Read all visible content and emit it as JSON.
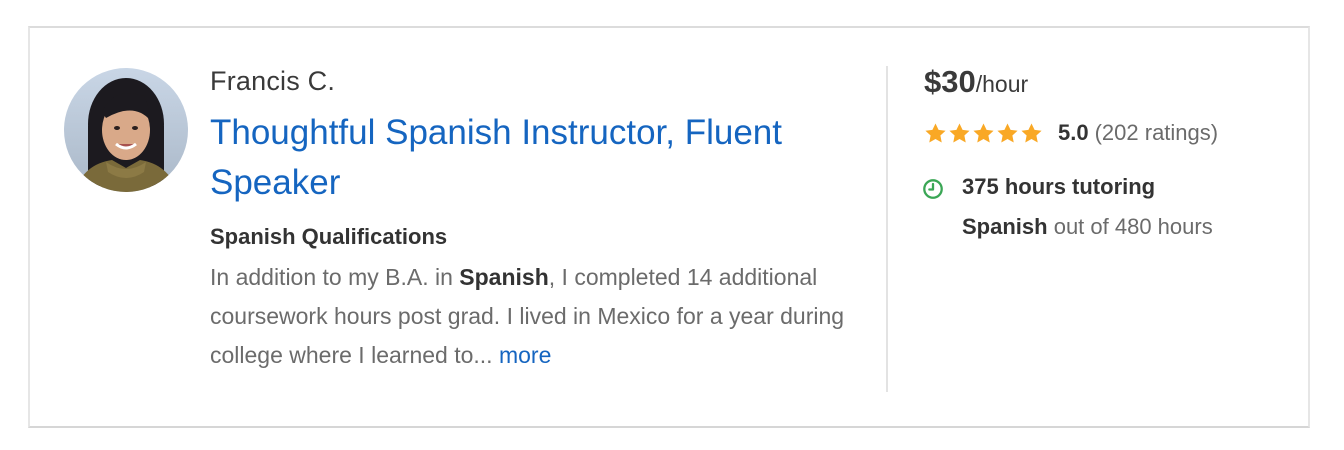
{
  "tutor": {
    "name": "Francis C.",
    "headline": "Thoughtful Spanish Instructor, Fluent Speaker",
    "qualifications": {
      "title": "Spanish Qualifications",
      "text_before_subject": "In addition to my B.A. in ",
      "subject": "Spanish",
      "text_after_subject": ", I completed 14 additional coursework hours post grad. I lived in Mexico for a year during college where I learned to...",
      "more_label": "more"
    }
  },
  "pricing": {
    "price": "$30",
    "unit": "/hour"
  },
  "rating": {
    "stars": 5,
    "score": "5.0",
    "count_text": "(202 ratings)",
    "star_color": "#f9a825"
  },
  "tutoring": {
    "hours_text": "375 hours tutoring",
    "subject": "Spanish",
    "total_text": "out of 480 hours",
    "icon": "clock-icon",
    "icon_color": "#3aa655"
  },
  "colors": {
    "link": "#1565c0",
    "text_dark": "#333333",
    "text_muted": "#6b6b6b"
  }
}
